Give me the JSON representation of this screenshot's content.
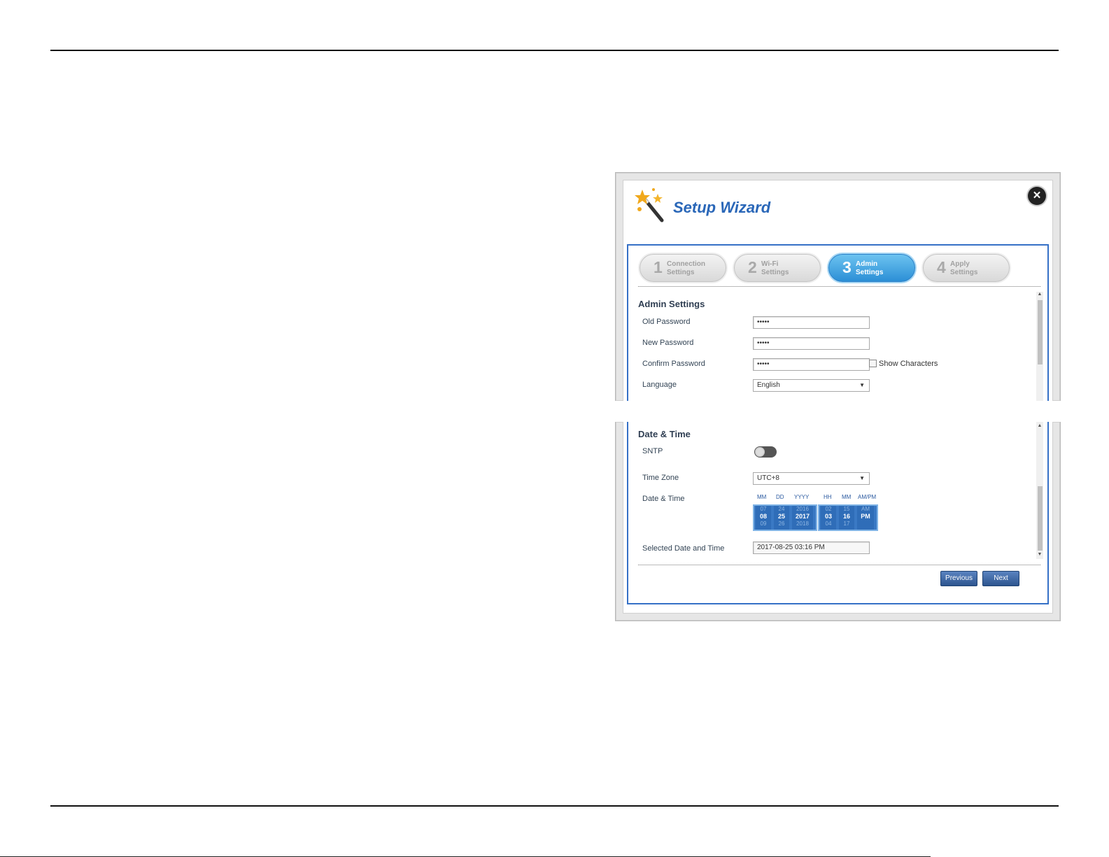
{
  "wizard": {
    "title": "Setup Wizard",
    "close_icon": "close-icon",
    "steps": [
      {
        "num": "1",
        "line1": "Connection",
        "line2": "Settings",
        "active": false
      },
      {
        "num": "2",
        "line1": "Wi-Fi",
        "line2": "Settings",
        "active": false
      },
      {
        "num": "3",
        "line1": "Admin",
        "line2": "Settings",
        "active": true
      },
      {
        "num": "4",
        "line1": "Apply",
        "line2": "Settings",
        "active": false
      }
    ]
  },
  "admin": {
    "section_title": "Admin Settings",
    "old_password_label": "Old Password",
    "old_password_value": "•••••",
    "new_password_label": "New Password",
    "new_password_value": "•••••",
    "confirm_password_label": "Confirm Password",
    "confirm_password_value": "•••••",
    "show_characters_label": "Show Characters",
    "language_label": "Language",
    "language_value": "English"
  },
  "datetime": {
    "section_title": "Date & Time",
    "sntp_label": "SNTP",
    "sntp_on": false,
    "timezone_label": "Time Zone",
    "timezone_value": "UTC+8",
    "datetime_label": "Date & Time",
    "picker_headers": {
      "mm": "MM",
      "dd": "DD",
      "yyyy": "YYYY",
      "hh": "HH",
      "min": "MM",
      "ampm": "AM/PM"
    },
    "picker": {
      "month": {
        "prev": "07",
        "cur": "08",
        "next": "09"
      },
      "day": {
        "prev": "24",
        "cur": "25",
        "next": "26"
      },
      "year": {
        "prev": "2016",
        "cur": "2017",
        "next": "2018"
      },
      "hour": {
        "prev": "02",
        "cur": "03",
        "next": "04"
      },
      "minute": {
        "prev": "15",
        "cur": "16",
        "next": "17"
      },
      "ampm": {
        "prev": "AM",
        "cur": "PM",
        "next": ""
      }
    },
    "selected_label": "Selected Date and Time",
    "selected_value": "2017-08-25 03:16 PM"
  },
  "buttons": {
    "previous": "Previous",
    "next": "Next"
  },
  "colors": {
    "accent_blue": "#3570c6",
    "title_blue": "#2a67b8",
    "active_step": "#2c8fd6",
    "button_blue": "#2d558f"
  }
}
